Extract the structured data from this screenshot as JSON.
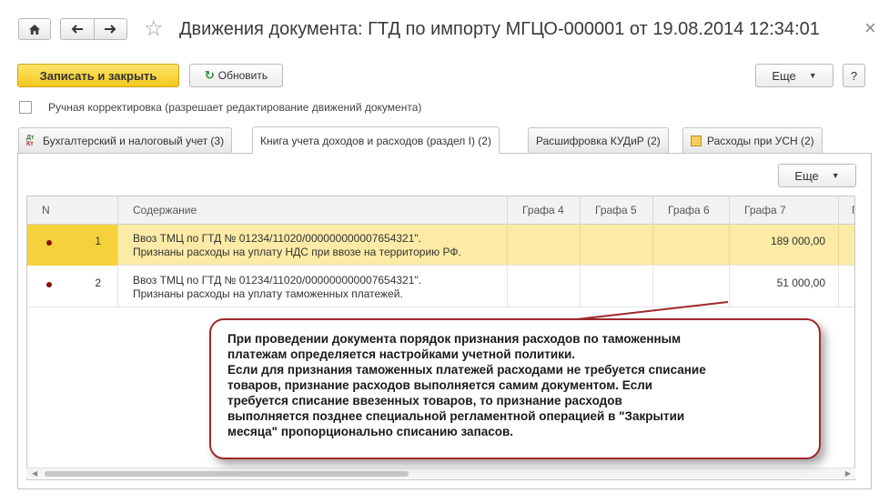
{
  "window": {
    "title": "Движения документа: ГТД по импорту МГЦО-000001 от 19.08.2014 12:34:01",
    "close_glyph": "×"
  },
  "toolbar": {
    "save_close_label": "Записать и закрыть",
    "refresh_label": "Обновить",
    "more_label": "Еще",
    "help_label": "?"
  },
  "manual_edit": {
    "label": "Ручная корректировка (разрешает редактирование движений документа)",
    "checked": false
  },
  "tabs": [
    {
      "label": "Бухгалтерский и налоговый учет (3)",
      "icon": "dt-kt-icon",
      "active": false
    },
    {
      "label": "Книга учета доходов и расходов (раздел I) (2)",
      "active": true
    },
    {
      "label": "Расшифровка КУДиР (2)",
      "active": false
    },
    {
      "label": "Расходы при УСН (2)",
      "icon": "document-icon",
      "active": false
    }
  ],
  "panel": {
    "more_label": "Еще"
  },
  "table": {
    "columns": [
      "N",
      "Содержание",
      "Графа 4",
      "Графа 5",
      "Графа 6",
      "Графа 7",
      "Г"
    ],
    "rows": [
      {
        "n": "1",
        "line1": "Ввоз ТМЦ по ГТД № 01234/11020/000000000007654321\".",
        "line2": "Признаны расходы на уплату НДС при ввозе на территорию РФ.",
        "g7": "189 000,00",
        "selected": true
      },
      {
        "n": "2",
        "line1": "Ввоз ТМЦ по ГТД № 01234/11020/000000000007654321\".",
        "line2": "Признаны расходы на уплату таможенных платежей.",
        "g7": "51 000,00",
        "selected": false
      }
    ]
  },
  "callout": {
    "lines": [
      "При проведении документа порядок признания расходов по таможенным",
      "платежам определяется настройками учетной политики.",
      "Если для признания таможенных платежей расходами не требуется списание",
      "товаров, признание расходов выполняется самим документом. Если",
      "требуется списание ввезенных товаров, то признание расходов",
      "выполняется позднее специальной регламентной операцией в \"Закрытии",
      "месяца\" пропорционально списанию запасов."
    ]
  },
  "colors": {
    "save_button": "#f5c81c",
    "selected_row": "#fbeba6",
    "callout_border": "#a0282c",
    "row_marker": "#8a1010"
  }
}
